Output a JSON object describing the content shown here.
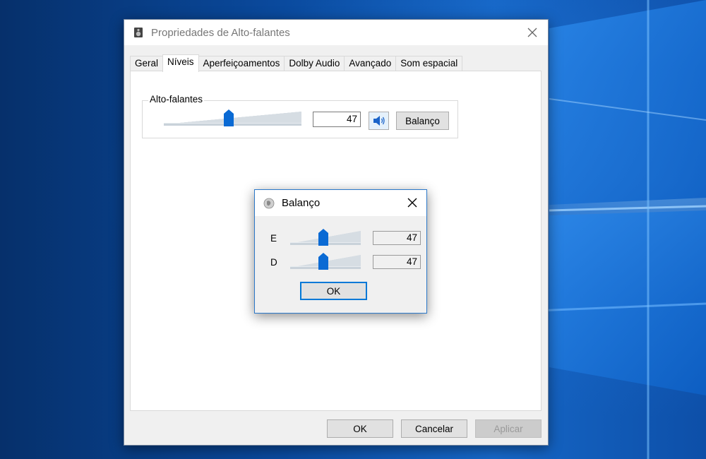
{
  "main_dialog": {
    "title": "Propriedades de Alto-falantes",
    "tabs": [
      {
        "label": "Geral"
      },
      {
        "label": "Níveis"
      },
      {
        "label": "Aperfeiçoamentos"
      },
      {
        "label": "Dolby Audio"
      },
      {
        "label": "Avançado"
      },
      {
        "label": "Som espacial"
      }
    ],
    "active_tab": "Níveis",
    "group_label": "Alto-falantes",
    "volume_value": "47",
    "volume_level": 0.47,
    "balance_button_label": "Balanço",
    "footer": {
      "ok_label": "OK",
      "cancel_label": "Cancelar",
      "apply_label": "Aplicar"
    }
  },
  "balance_dialog": {
    "title": "Balanço",
    "left_label": "E",
    "left_value": "47",
    "left_level": 0.47,
    "right_label": "D",
    "right_value": "47",
    "right_level": 0.47,
    "ok_label": "OK"
  },
  "colors": {
    "accent": "#0078d7",
    "slider_thumb": "#0a6ad4",
    "dialog_bg": "#f0f0f0"
  }
}
